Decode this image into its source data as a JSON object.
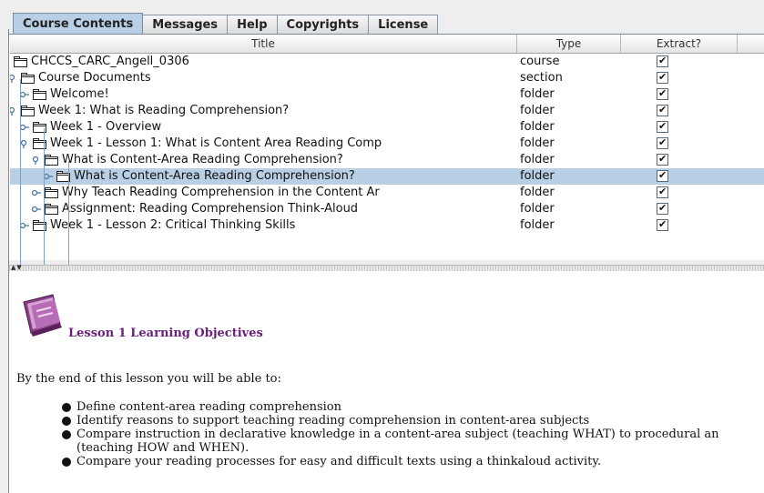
{
  "tabs": [
    {
      "label": "Course Contents",
      "active": true
    },
    {
      "label": "Messages",
      "active": false
    },
    {
      "label": "Help",
      "active": false
    },
    {
      "label": "Copyrights",
      "active": false
    },
    {
      "label": "License",
      "active": false
    }
  ],
  "table": {
    "columns": [
      "Title",
      "Type",
      "Extract?",
      ""
    ],
    "rows": [
      {
        "title": "CHCCS_CARC_Angell_0306",
        "type": "course",
        "extract": true,
        "level": 0,
        "expanded": null,
        "selected": false
      },
      {
        "title": "Course Documents",
        "type": "section",
        "extract": true,
        "level": 1,
        "expanded": true,
        "selected": false
      },
      {
        "title": "Welcome!",
        "type": "folder",
        "extract": true,
        "level": 2,
        "expanded": false,
        "selected": false
      },
      {
        "title": "Week 1: What is Reading Comprehension?",
        "type": "folder",
        "extract": true,
        "level": 1,
        "expanded": true,
        "selected": false
      },
      {
        "title": "Week 1 - Overview",
        "type": "folder",
        "extract": true,
        "level": 2,
        "expanded": false,
        "selected": false
      },
      {
        "title": "Week 1 - Lesson 1: What is Content Area Reading Comp",
        "type": "folder",
        "extract": true,
        "level": 2,
        "expanded": true,
        "selected": false
      },
      {
        "title": "What is Content-Area Reading Comprehension?",
        "type": "folder",
        "extract": true,
        "level": 3,
        "expanded": true,
        "selected": false
      },
      {
        "title": "What is Content-Area Reading Comprehension?",
        "type": "folder",
        "extract": true,
        "level": 4,
        "expanded": false,
        "selected": true
      },
      {
        "title": "Why Teach Reading Comprehension in the Content Ar",
        "type": "folder",
        "extract": true,
        "level": 3,
        "expanded": false,
        "selected": false
      },
      {
        "title": "Assignment: Reading Comprehension Think-Aloud",
        "type": "folder",
        "extract": true,
        "level": 3,
        "expanded": false,
        "selected": false
      },
      {
        "title": "Week 1 - Lesson 2: Critical Thinking Skills",
        "type": "folder",
        "extract": true,
        "level": 2,
        "expanded": false,
        "selected": false
      }
    ]
  },
  "content": {
    "icon": "book-icon",
    "heading": "Lesson 1 Learning Objectives",
    "intro": "By the end of this lesson you will be able to:",
    "bullets": [
      {
        "text": "Define content-area reading comprehension"
      },
      {
        "text": "Identify reasons to support teaching reading comprehension in content-area subjects"
      },
      {
        "text": "Compare instruction in declarative knowledge in a content-area subject (teaching WHAT) to procedural an",
        "cont": "(teaching HOW and WHEN)."
      },
      {
        "text": "Compare your reading processes for easy and difficult texts using a thinkaloud activity."
      }
    ]
  },
  "colors": {
    "selection": "#b8cfe5",
    "heading": "#6a1f7a",
    "tree_line": "#7fa0c0"
  }
}
